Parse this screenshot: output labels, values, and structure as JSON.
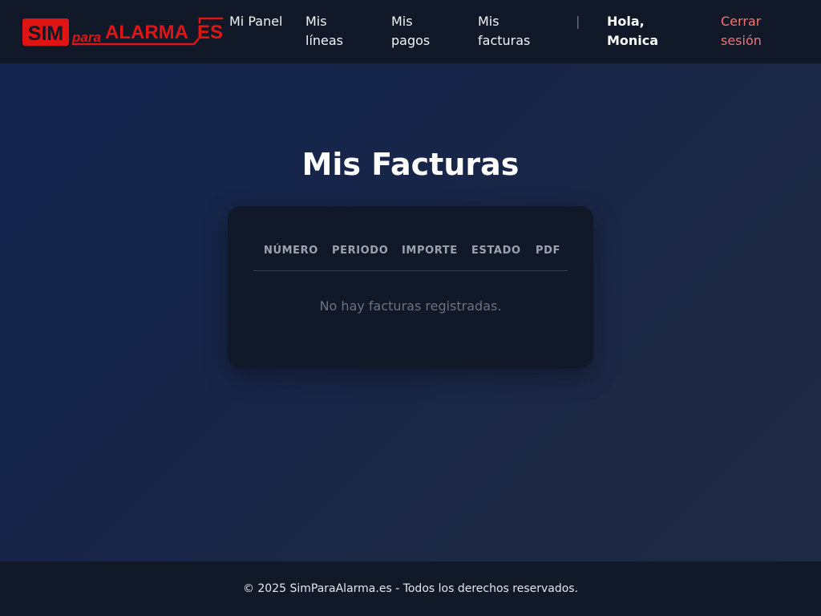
{
  "header": {
    "logo": {
      "prefix": "SIM",
      "middle": "para",
      "brand": "ALARMA",
      "suffix": "ES"
    },
    "nav": [
      {
        "label": "Mi Panel"
      },
      {
        "label": "Mis líneas"
      },
      {
        "label": "Mis pagos"
      },
      {
        "label": "Mis facturas"
      }
    ],
    "separator": "|",
    "greeting": "Hola, Monica",
    "logout_label": "Cerrar sesión"
  },
  "main": {
    "title": "Mis Facturas",
    "table": {
      "columns": [
        "NÚMERO",
        "PERIODO",
        "IMPORTE",
        "ESTADO",
        "PDF"
      ],
      "rows": [],
      "empty_message": "No hay facturas registradas."
    }
  },
  "footer": {
    "text": "© 2025 SimParaAlarma.es - Todos los derechos reservados."
  },
  "colors": {
    "brand_red": "#e11414",
    "header_bg": "#111827",
    "logout": "#f87171"
  }
}
